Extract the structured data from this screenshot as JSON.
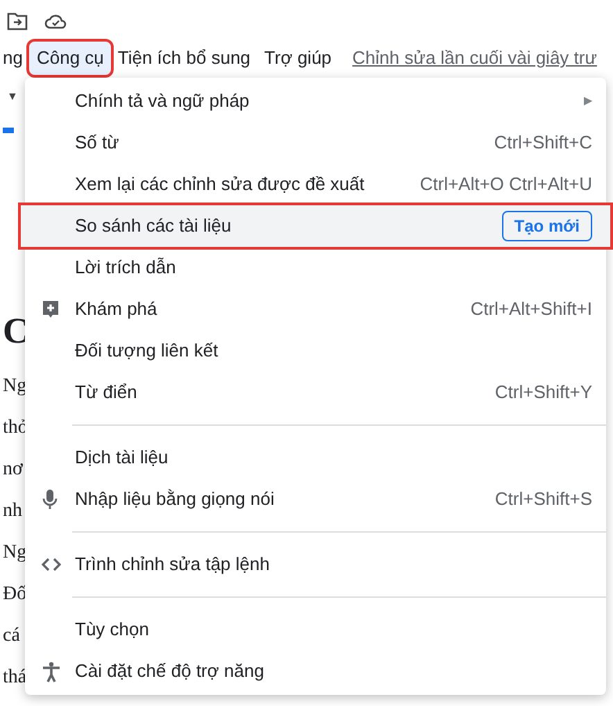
{
  "menu_bar": [
    {
      "label": "ng",
      "selected": false,
      "highlighted": false
    },
    {
      "label": "Công cụ",
      "selected": true,
      "highlighted": true
    },
    {
      "label": "Tiện ích bổ sung",
      "selected": false,
      "highlighted": false
    },
    {
      "label": "Trợ giúp",
      "selected": false,
      "highlighted": false
    }
  ],
  "last_edit_link": "Chỉnh sửa lần cuối vài giây trư",
  "toolbar_caret": "▼",
  "document_fragments": [
    {
      "text": "C",
      "kind": "heading"
    },
    {
      "text": "Ng",
      "kind": "body"
    },
    {
      "text": "thỏ",
      "kind": "body"
    },
    {
      "text": "nơ",
      "kind": "body"
    },
    {
      "text": "nh",
      "kind": "body"
    },
    {
      "text": "Ng",
      "kind": "body"
    },
    {
      "text": "Đố",
      "kind": "body"
    },
    {
      "text": "cá",
      "kind": "body"
    },
    {
      "text": "thá",
      "kind": "body"
    }
  ],
  "menu": [
    {
      "kind": "item",
      "label": "Chính tả và ngữ pháp",
      "submenu_arrow": "▶",
      "highlighted": false
    },
    {
      "kind": "item",
      "label": "Số từ",
      "shortcut": "Ctrl+Shift+C",
      "highlighted": false
    },
    {
      "kind": "item",
      "label": "Xem lại các chỉnh sửa được đề xuất",
      "shortcut": "Ctrl+Alt+O Ctrl+Alt+U",
      "highlighted": false
    },
    {
      "kind": "item",
      "label": "So sánh các tài liệu",
      "badge": "Tạo mới",
      "highlighted": true
    },
    {
      "kind": "item",
      "label": "Lời trích dẫn",
      "highlighted": false
    },
    {
      "kind": "discover",
      "label": "Khám phá",
      "shortcut": "Ctrl+Alt+Shift+I",
      "highlighted": false
    },
    {
      "kind": "item",
      "label": "Đối tượng liên kết",
      "highlighted": false
    },
    {
      "kind": "item",
      "label": "Từ điển",
      "shortcut": "Ctrl+Shift+Y",
      "highlighted": false
    },
    {
      "kind": "divider"
    },
    {
      "kind": "item",
      "label": "Dịch tài liệu",
      "highlighted": false
    },
    {
      "kind": "voice",
      "label": "Nhập liệu bằng giọng nói",
      "shortcut": "Ctrl+Shift+S",
      "highlighted": false
    },
    {
      "kind": "divider"
    },
    {
      "kind": "script",
      "label": "Trình chỉnh sửa tập lệnh",
      "highlighted": false
    },
    {
      "kind": "divider"
    },
    {
      "kind": "item",
      "label": "Tùy chọn",
      "highlighted": false
    },
    {
      "kind": "accessibility",
      "label": "Cài đặt chế độ trợ năng",
      "highlighted": false
    }
  ]
}
